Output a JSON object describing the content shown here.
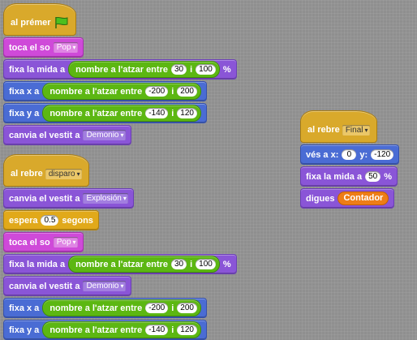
{
  "script1": {
    "hat_label": "al prémer",
    "flag_icon": "green-flag-icon",
    "b1": {
      "label": "toca el so",
      "dropdown": "Pop"
    },
    "b2": {
      "label": "fixa la mida a",
      "op_label": "nombre a l'atzar entre",
      "v1": "30",
      "sep": "i",
      "v2": "100",
      "suffix": "%"
    },
    "b3": {
      "label": "fixa x a",
      "op_label": "nombre a l'atzar entre",
      "v1": "-200",
      "sep": "i",
      "v2": "200"
    },
    "b4": {
      "label": "fixa y a",
      "op_label": "nombre a l'atzar entre",
      "v1": "-140",
      "sep": "i",
      "v2": "120"
    },
    "b5": {
      "label": "canvia el vestit a",
      "dropdown": "Demonio"
    }
  },
  "script2": {
    "hat_label": "al rebre",
    "hat_dropdown": "disparo",
    "b1": {
      "label": "canvia el vestit a",
      "dropdown": "Explosión"
    },
    "b2": {
      "label": "espera",
      "value": "0.5",
      "suffix": "segons"
    },
    "b3": {
      "label": "toca el so",
      "dropdown": "Pop"
    },
    "b4": {
      "label": "fixa la mida a",
      "op_label": "nombre a l'atzar entre",
      "v1": "30",
      "sep": "i",
      "v2": "100",
      "suffix": "%"
    },
    "b5": {
      "label": "canvia el vestit a",
      "dropdown": "Demonio"
    },
    "b6": {
      "label": "fixa x a",
      "op_label": "nombre a l'atzar entre",
      "v1": "-200",
      "sep": "i",
      "v2": "200"
    },
    "b7": {
      "label": "fixa y a",
      "op_label": "nombre a l'atzar entre",
      "v1": "-140",
      "sep": "i",
      "v2": "120"
    }
  },
  "script3": {
    "hat_label": "al rebre",
    "hat_dropdown": "Final",
    "b1": {
      "label": "vés a x:",
      "x": "0",
      "y_label": "y:",
      "y": "-120"
    },
    "b2": {
      "label": "fixa la mida a",
      "value": "50",
      "suffix": "%"
    },
    "b3": {
      "label": "digues",
      "var": "Contador"
    }
  },
  "colors": {
    "looks": "#8a55d7",
    "sound": "#cf4ad9",
    "motion": "#4a6cd4",
    "control": "#e1a91a",
    "operator": "#5cb712",
    "variable": "#ee7d16",
    "background": "#8f8f8f"
  }
}
